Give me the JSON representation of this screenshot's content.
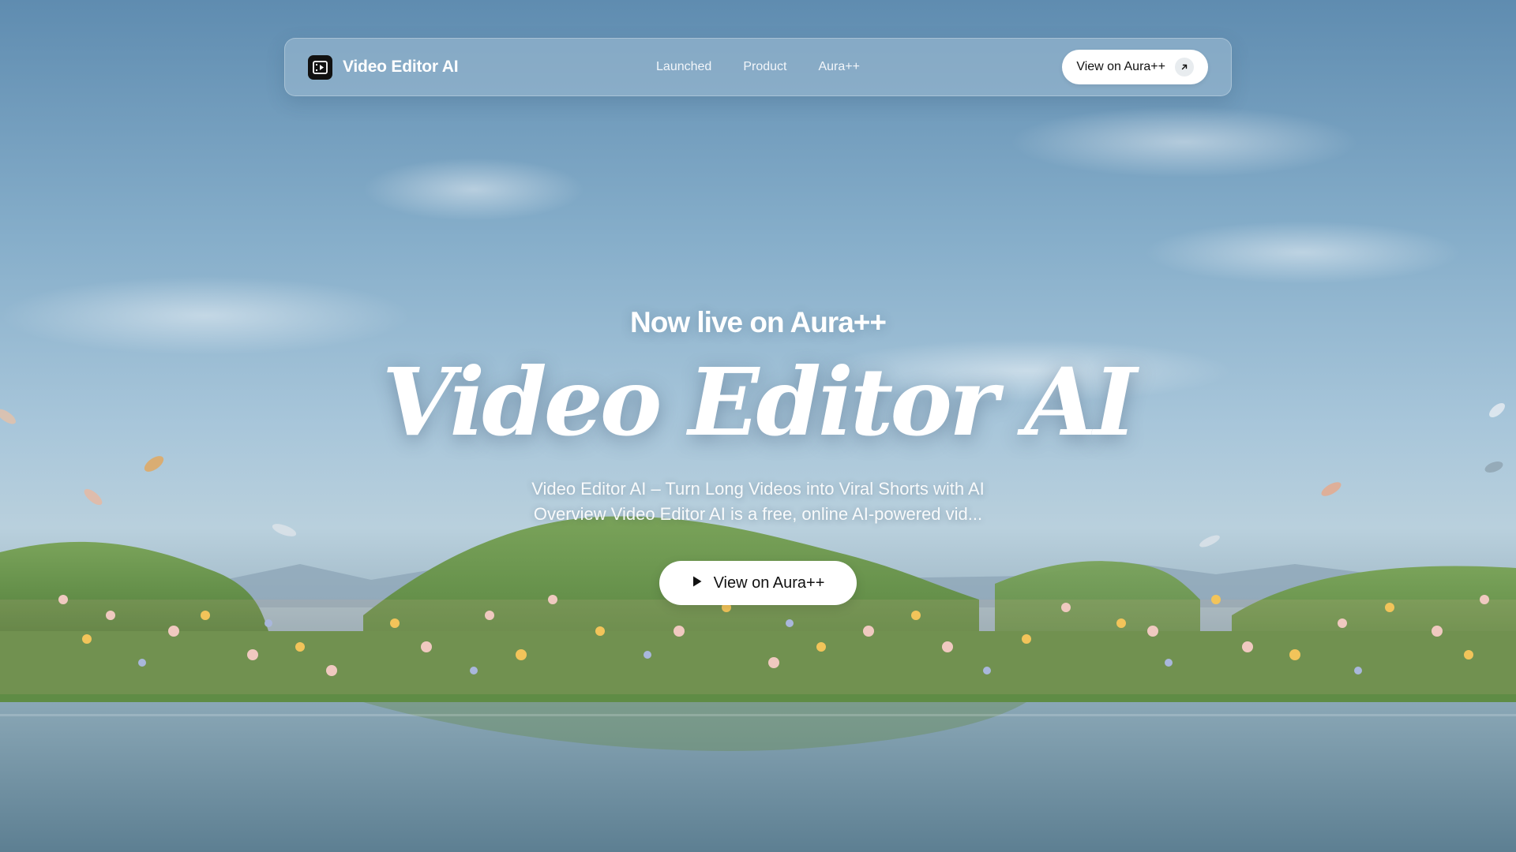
{
  "nav": {
    "brand_name": "Video Editor AI",
    "links": [
      "Launched",
      "Product",
      "Aura++"
    ],
    "cta_label": "View on Aura++"
  },
  "hero": {
    "eyebrow": "Now live on Aura++",
    "title": "Video Editor AI",
    "description_line1": "Video Editor AI – Turn Long Videos into Viral Shorts with AI",
    "description_line2": "Overview Video Editor AI is a free, online AI-powered vid...",
    "cta_label": "View on Aura++"
  },
  "icons": {
    "brand_logo": "video-editor-logo-icon",
    "nav_cta_icon": "arrow-up-right-icon",
    "hero_cta_icon": "play-icon"
  },
  "colors": {
    "sky_top": "#5f8cb0",
    "sky_mid": "#a8c6da",
    "hill_green": "#5e8a45",
    "button_bg": "#ffffff",
    "text_dark": "#111111"
  }
}
